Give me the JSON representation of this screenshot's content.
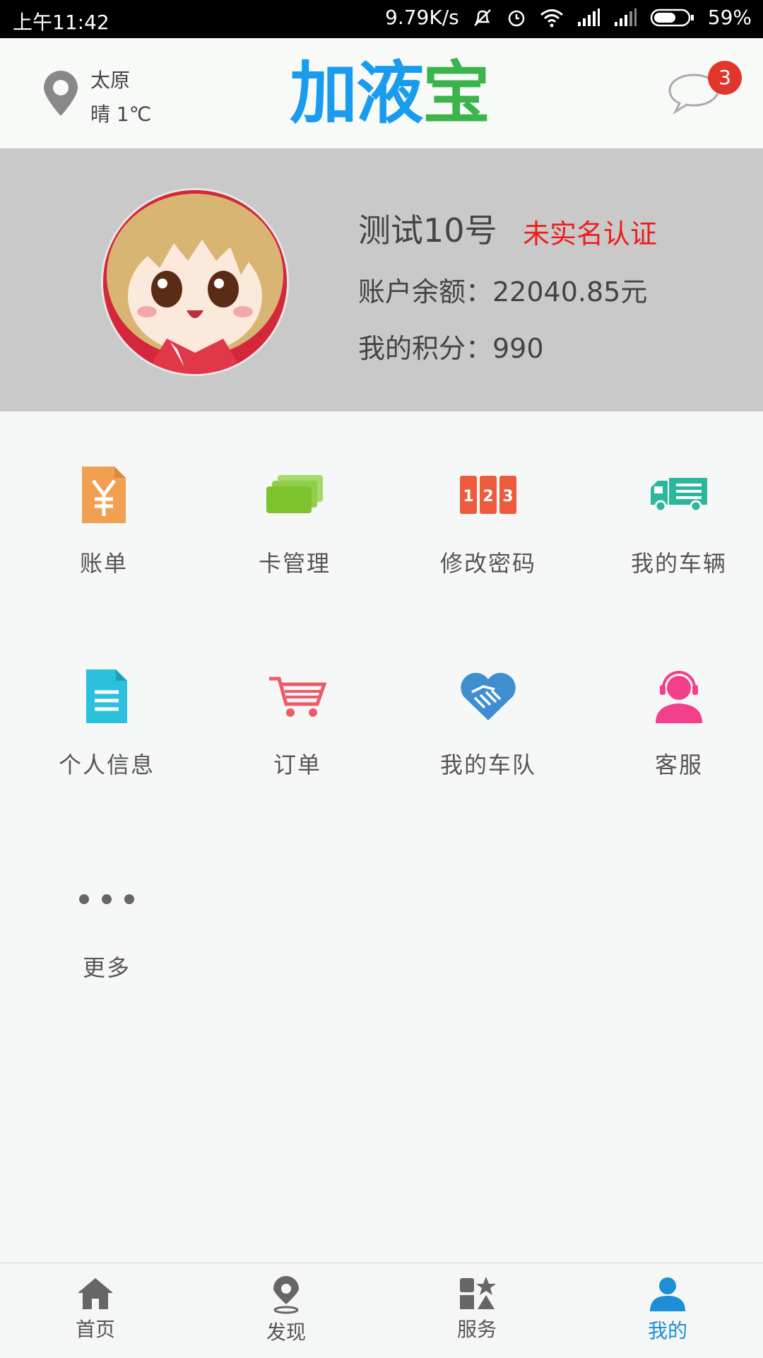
{
  "status_bar": {
    "time": "上午11:42",
    "net_speed": "9.79K/s",
    "battery": "59%"
  },
  "header": {
    "city": "太原",
    "weather": "晴 1℃",
    "logo_text": "加液",
    "logo_text_last": "宝",
    "message_count": "3"
  },
  "profile": {
    "name": "测试10号",
    "verify_status": "未实名认证",
    "balance": "账户余额：22040.85元",
    "points": "我的积分：990"
  },
  "menu": [
    {
      "label": "账单",
      "icon": "bill-icon",
      "color": "#f0a050"
    },
    {
      "label": "卡管理",
      "icon": "cards-icon",
      "color": "#7cc32e"
    },
    {
      "label": "修改密码",
      "icon": "password-123-icon",
      "color": "#ee5a3c"
    },
    {
      "label": "我的车辆",
      "icon": "truck-icon",
      "color": "#2cb79c"
    },
    {
      "label": "个人信息",
      "icon": "document-icon",
      "color": "#2bc1dc"
    },
    {
      "label": "订单",
      "icon": "cart-icon",
      "color": "#ef5a69"
    },
    {
      "label": "我的车队",
      "icon": "handshake-heart-icon",
      "color": "#3f8fd0"
    },
    {
      "label": "客服",
      "icon": "customer-service-icon",
      "color": "#f43f8a"
    },
    {
      "label": "更多",
      "icon": "more-dots-icon",
      "color": "#666666"
    }
  ],
  "bottom_nav": [
    {
      "label": "首页",
      "icon": "home-icon"
    },
    {
      "label": "发现",
      "icon": "location-icon"
    },
    {
      "label": "服务",
      "icon": "services-icon"
    },
    {
      "label": "我的",
      "icon": "person-icon",
      "active": true
    }
  ]
}
